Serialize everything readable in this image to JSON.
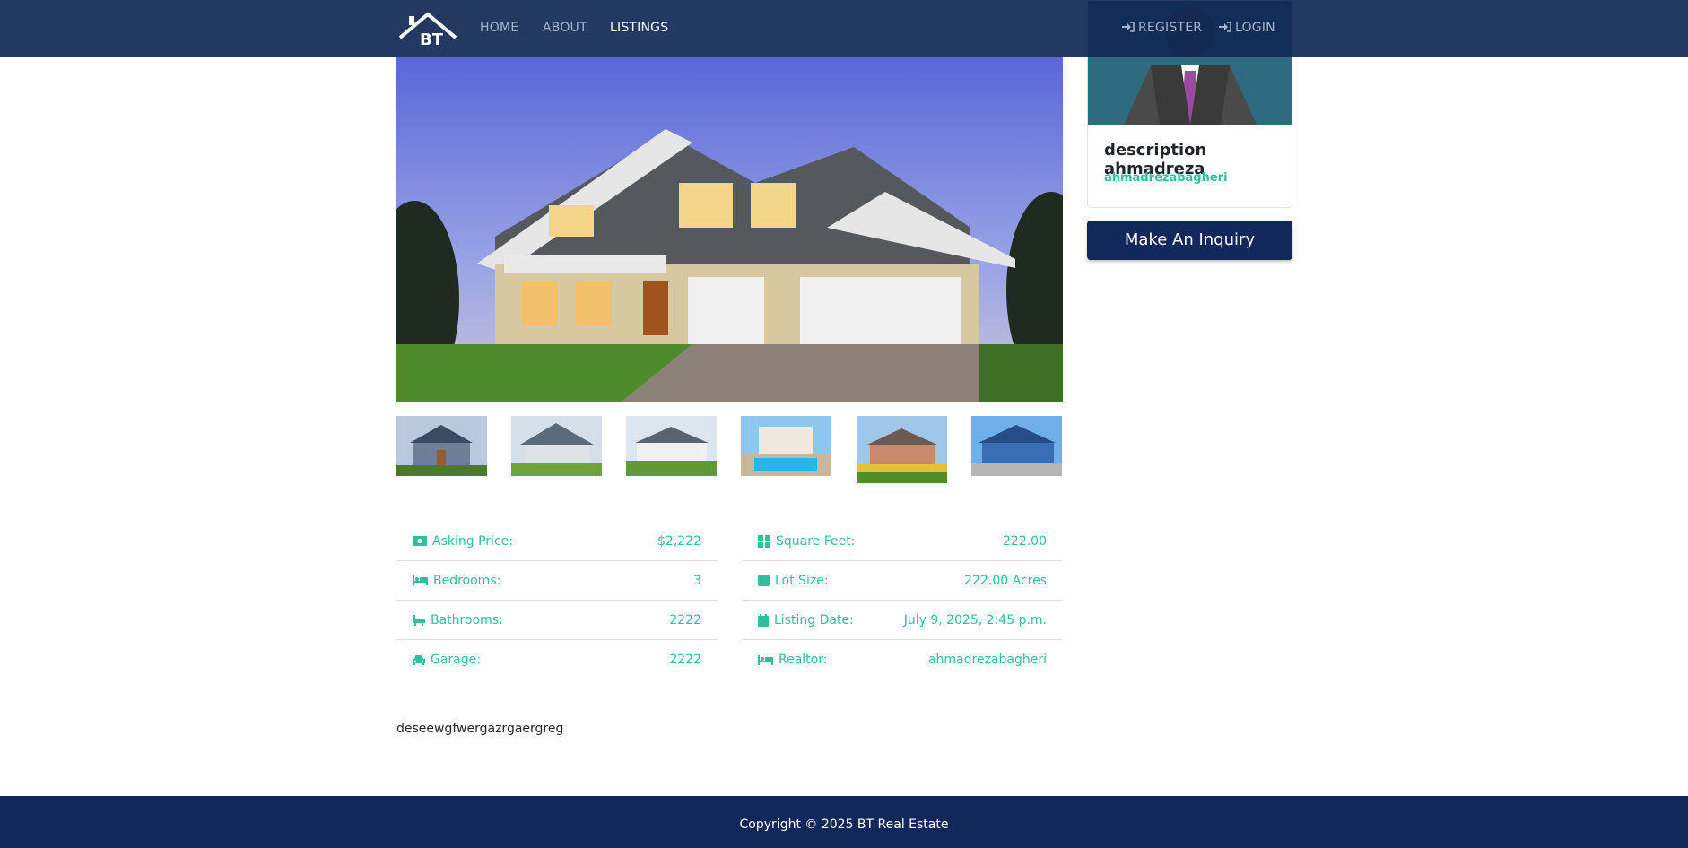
{
  "nav": {
    "logo_text": "BT",
    "home": "HOME",
    "about": "ABOUT",
    "listings": "LISTINGS",
    "register": "REGISTER",
    "login": "LOGIN"
  },
  "details": {
    "left": [
      {
        "icon": "money-icon",
        "label": "Asking Price:",
        "value": "$2,222"
      },
      {
        "icon": "bed-icon",
        "label": "Bedrooms:",
        "value": "3"
      },
      {
        "icon": "bath-icon",
        "label": "Bathrooms:",
        "value": "2222"
      },
      {
        "icon": "car-icon",
        "label": "Garage:",
        "value": "2222"
      }
    ],
    "right": [
      {
        "icon": "grid-icon",
        "label": "Square Feet:",
        "value": "222.00"
      },
      {
        "icon": "square-icon",
        "label": "Lot Size:",
        "value": "222.00 Acres"
      },
      {
        "icon": "calendar-icon",
        "label": "Listing Date:",
        "value": "July 9, 2025, 2:45 p.m."
      },
      {
        "icon": "bed-icon",
        "label": "Realtor:",
        "value": "ahmadrezabagheri"
      }
    ]
  },
  "description": "deseewgfwergazrgaergreg",
  "realtor": {
    "name": "description ahmadreza",
    "username": "ahmadrezabagheri"
  },
  "inquiry_button": "Make An Inquiry",
  "footer": {
    "copyright": "Copyright © 2025 BT Real Estate"
  },
  "colors": {
    "navbar": "#102854",
    "accent": "#2fbf9b",
    "button": "#10285a"
  }
}
